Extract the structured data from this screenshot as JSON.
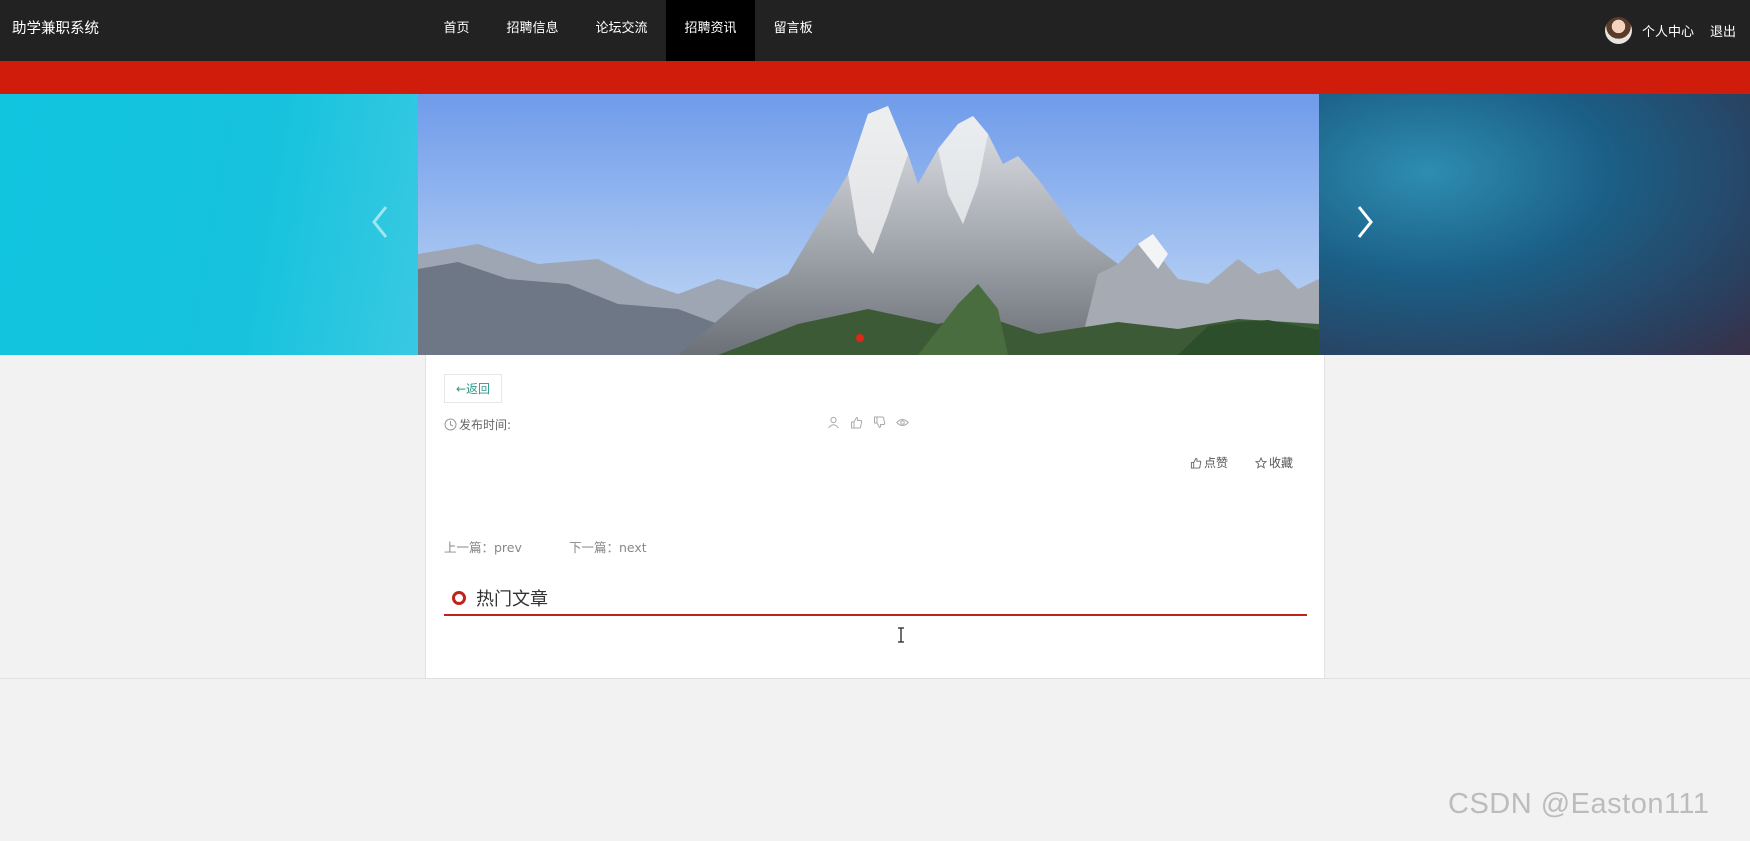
{
  "header": {
    "brand": "助学兼职系统",
    "nav": [
      "首页",
      "招聘信息",
      "论坛交流",
      "招聘资讯",
      "留言板"
    ],
    "active_index": 3,
    "user_center": "个人中心",
    "logout": "退出"
  },
  "colors": {
    "topbar": "#222222",
    "accent_red": "#d01c0a",
    "back_text": "#2f9688",
    "hot_line": "#c0231a"
  },
  "carousel": {
    "image": "mountain-landscape",
    "prev_icon": "chevron-left-icon",
    "next_icon": "chevron-right-icon"
  },
  "article": {
    "back_label": "←返回",
    "publish_label": "发布时间:",
    "like_label": "点赞",
    "favorite_label": "收藏",
    "prev_label": "上一篇：prev",
    "next_label": "下一篇：next"
  },
  "hot": {
    "title": "热门文章"
  },
  "watermark": "CSDN @Easton111"
}
